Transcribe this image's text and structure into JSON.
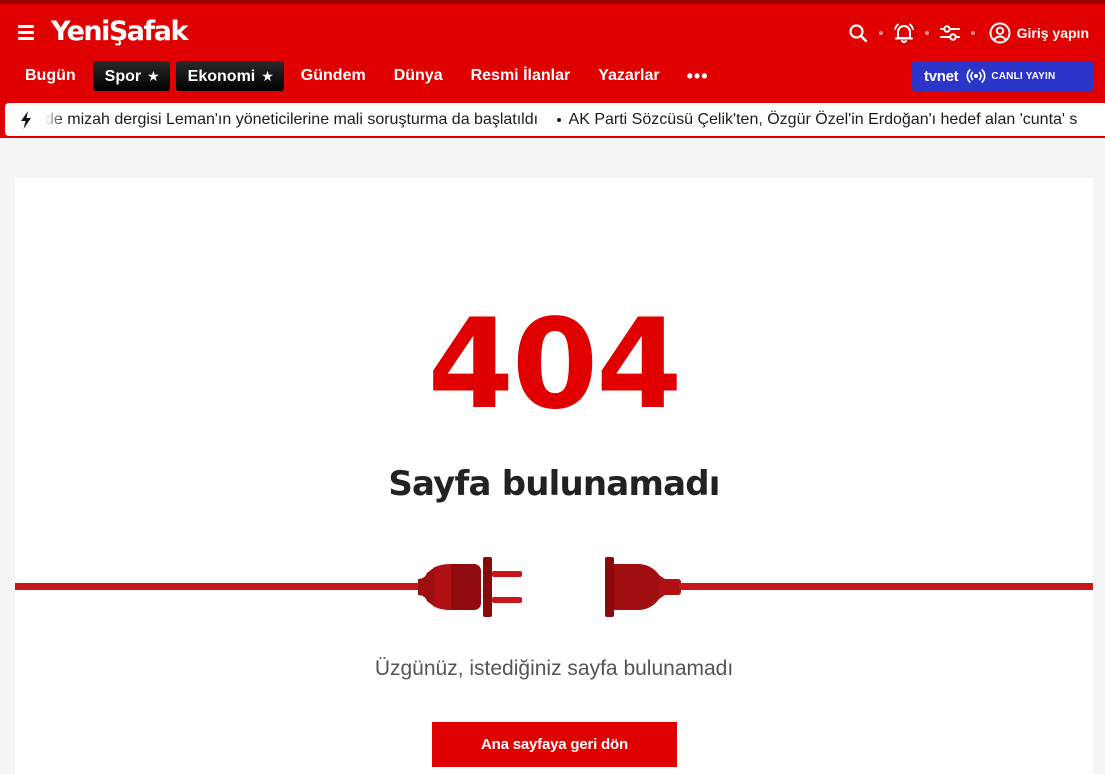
{
  "header": {
    "logo_text": "YeniŞafak",
    "login_label": "Giriş yapın",
    "icons": [
      "menu-icon",
      "search-icon",
      "bell-icon",
      "sliders-icon",
      "user-icon"
    ],
    "colors": {
      "brand_red": "#e00000",
      "live_blue": "#2b35c9"
    }
  },
  "nav": {
    "items": [
      {
        "label": "Bugün",
        "starred": false
      },
      {
        "label": "Spor",
        "starred": true
      },
      {
        "label": "Ekonomi",
        "starred": true
      },
      {
        "label": "Gündem",
        "starred": false
      },
      {
        "label": "Dünya",
        "starred": false
      },
      {
        "label": "Resmi İlanlar",
        "starred": false
      },
      {
        "label": "Yazarlar",
        "starred": false
      }
    ],
    "star": "★",
    "more_label": "•••"
  },
  "live": {
    "brand": "tvnet",
    "label": "CANLI YAYIN"
  },
  "ticker": {
    "items": [
      "de mizah dergisi Leman'ın yöneticilerine mali soruşturma da başlatıldı",
      "AK Parti Sözcüsü Çelik'ten, Özgür Özel'in Erdoğan'ı hedef alan 'cunta' s"
    ]
  },
  "error": {
    "code": "404",
    "title": "Sayfa bulunamadı",
    "message": "Üzgünüz, istediğiniz sayfa bulunamadı",
    "home_button": "Ana sayfaya geri dön"
  }
}
